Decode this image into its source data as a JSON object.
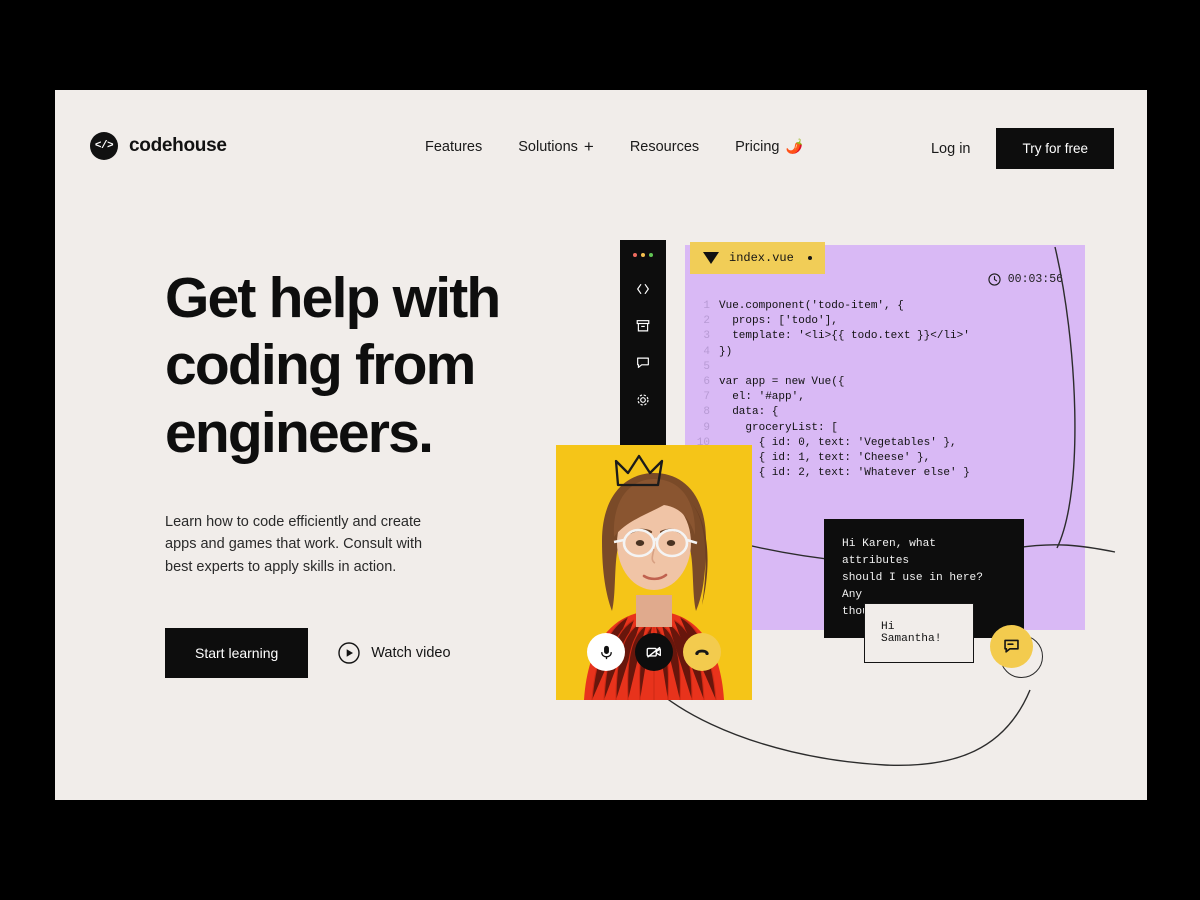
{
  "brand": {
    "name": "codehouse",
    "logo_icon": "code-slash-icon"
  },
  "nav": {
    "items": [
      {
        "label": "Features",
        "suffix": ""
      },
      {
        "label": "Solutions",
        "suffix": "+"
      },
      {
        "label": "Resources",
        "suffix": ""
      },
      {
        "label": "Pricing",
        "suffix": "🌶️"
      }
    ],
    "login_label": "Log in",
    "cta_label": "Try for free"
  },
  "hero": {
    "title": "Get help with coding from engineers.",
    "subtitle": "Learn how to code efficiently and create apps and games that work. Consult with best experts to apply skills in action.",
    "primary_cta": "Start learning",
    "secondary_cta": "Watch video",
    "secondary_icon": "play-circle-icon"
  },
  "ide": {
    "window_dots": [
      "#ed6a5e",
      "#f4bf4f",
      "#61c454"
    ],
    "sidebar_icons": [
      "code-brackets-icon",
      "archive-box-icon",
      "chat-bubble-icon",
      "gear-icon"
    ],
    "tab": {
      "label": "index.vue",
      "icon": "vue-logo-icon",
      "modified_dot": true
    },
    "timer": {
      "icon": "clock-icon",
      "value": "00:03:56"
    },
    "line_numbers": [
      "1",
      "2",
      "3",
      "4",
      "5",
      "6",
      "7",
      "8",
      "9",
      "10",
      "",
      "",
      "",
      "",
      ""
    ],
    "code": "Vue.component('todo-item', {\n  props: ['todo'],\n  template: '<li>{{ todo.text }}</li>'\n})\n\nvar app = new Vue({\n  el: '#app',\n  data: {\n    groceryList: [\n      { id: 0, text: 'Vegetables' },\n      { id: 1, text: 'Cheese' },\n      { id: 2, text: 'Whatever else' }\n    ]\n  }\n})"
  },
  "video_call": {
    "participant_alt": "Woman with glasses in red sweater on yellow background",
    "crown_decoration": "crown-doodle",
    "buttons": [
      {
        "name": "microphone-button",
        "icon": "microphone-icon",
        "state": "on"
      },
      {
        "name": "camera-button",
        "icon": "camera-off-icon",
        "state": "off"
      },
      {
        "name": "end-call-button",
        "icon": "phone-hangup-icon",
        "state": "end"
      }
    ]
  },
  "chat": {
    "incoming_message": "Hi Karen, what attributes\nshould I use in here? Any\nthoughts on that?",
    "outgoing_message": "Hi Samantha!",
    "fab_icon": "chat-bubble-icon"
  },
  "colors": {
    "page_bg": "#f1edea",
    "outer_bg": "#000000",
    "ink": "#0d0d0d",
    "code_panel": "#d9b9f5",
    "tab_yellow": "#f1cd57",
    "accent_yellow": "#f3cb4e",
    "video_bg": "#f5c518",
    "sweater_red": "#e8331c"
  }
}
